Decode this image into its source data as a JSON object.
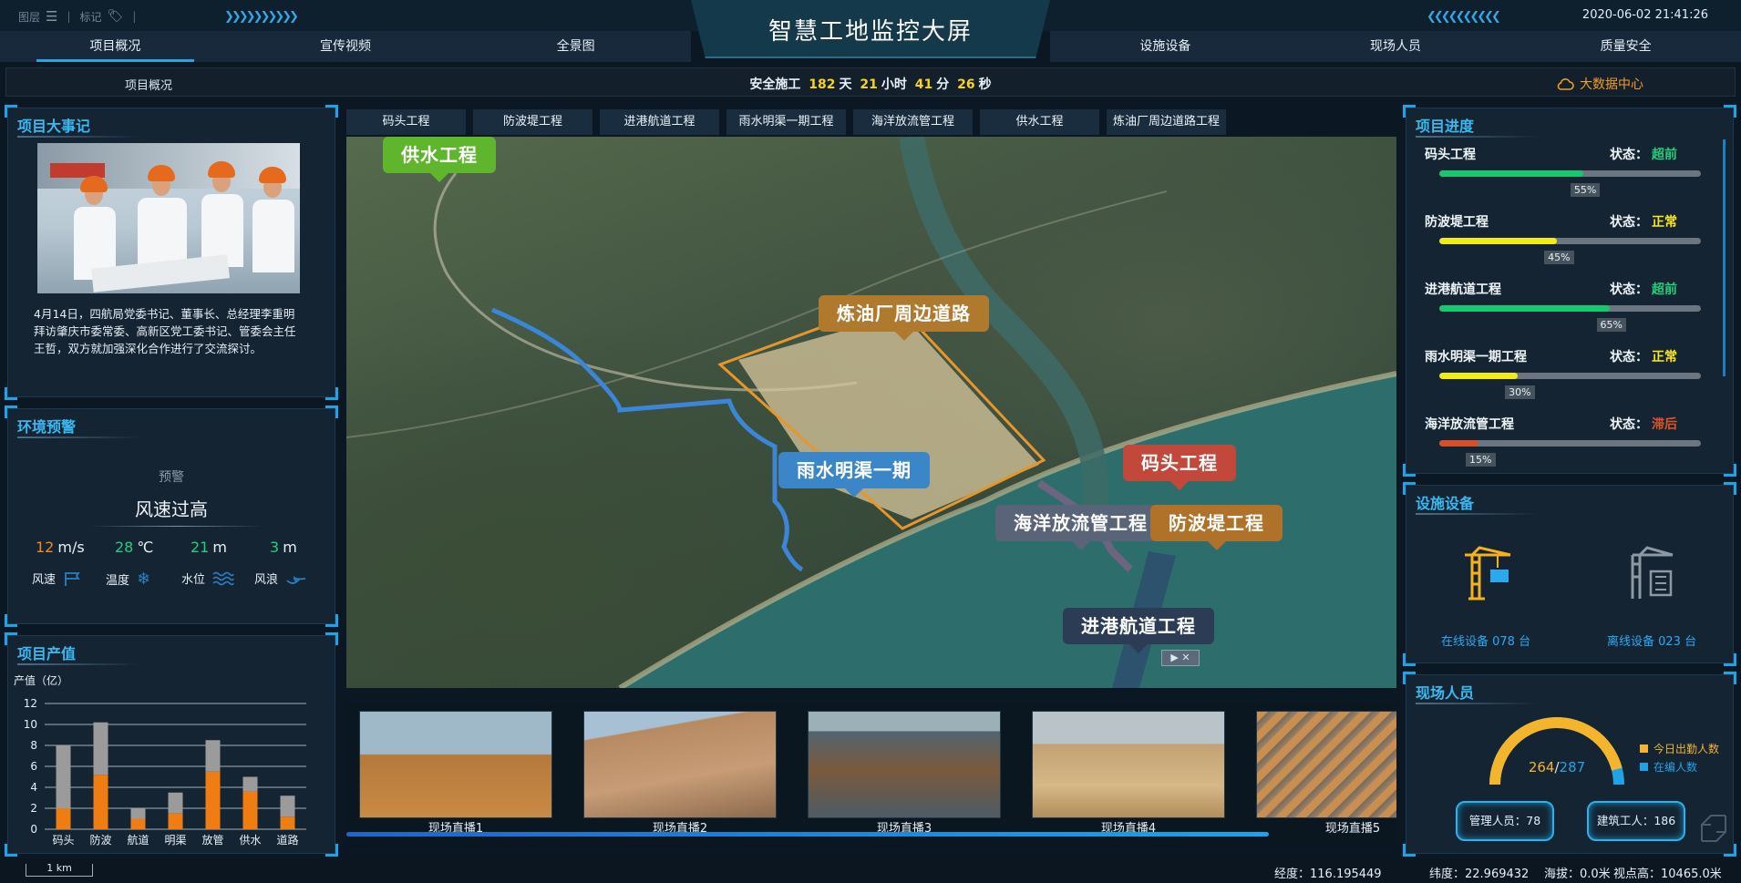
{
  "toolbar": {
    "layers_label": "图层",
    "mark_label": "标记",
    "sep": "|"
  },
  "datetime": "2020-06-02 21:41:26",
  "title": "智慧工地监控大屏",
  "nav": {
    "left": [
      "项目概况",
      "宣传视频",
      "全景图"
    ],
    "right": [
      "设施设备",
      "现场人员",
      "质量安全"
    ],
    "active": "项目概况"
  },
  "strip": {
    "label": "项目概况",
    "safety_prefix": "安全施工",
    "days": "182",
    "days_unit": "天",
    "hours": "21",
    "hours_unit": "小时",
    "minutes": "41",
    "minutes_unit": "分",
    "seconds": "26",
    "seconds_unit": "秒",
    "bigdata": "大数据中心"
  },
  "events": {
    "title": "项目大事记",
    "text": "4月14日，四航局党委书记、董事长、总经理李重明拜访肇庆市委常委、高新区党工委书记、管委会主任王哲，双方就加强深化合作进行了交流探讨。"
  },
  "env": {
    "title": "环境预警",
    "tag": "预警",
    "main": "风速过高",
    "metrics": [
      {
        "value": "12",
        "unit": "m/s",
        "label": "风速",
        "color": "#f08a24",
        "icon": "wind-icon"
      },
      {
        "value": "28",
        "unit": "℃",
        "label": "温度",
        "color": "#1fd07a",
        "icon": "temperature-icon"
      },
      {
        "value": "21",
        "unit": "m",
        "label": "水位",
        "color": "#1fd07a",
        "icon": "water-level-icon"
      },
      {
        "value": "3",
        "unit": "m",
        "label": "风浪",
        "color": "#1fd07a",
        "icon": "wave-icon"
      }
    ]
  },
  "output": {
    "title": "项目产值",
    "unit_label": "产值（亿）"
  },
  "chart_data": {
    "type": "bar",
    "stacked": true,
    "categories": [
      "码头",
      "防波",
      "航道",
      "明渠",
      "放管",
      "供水",
      "道路"
    ],
    "series": [
      {
        "values": [
          2,
          5.2,
          1,
          1.5,
          5.5,
          3.6,
          1.2
        ],
        "color": "#f07d11"
      },
      {
        "values": [
          6,
          5,
          1,
          2,
          3,
          1.4,
          2
        ],
        "color": "#9b9b9b"
      }
    ],
    "ylabel": "产值（亿）",
    "ylim": [
      0,
      12
    ],
    "yticks": [
      0,
      2,
      4,
      6,
      8,
      10,
      12
    ],
    "grid": true
  },
  "project_tabs": [
    "码头工程",
    "防波堤工程",
    "进港航道工程",
    "雨水明渠一期工程",
    "海洋放流管工程",
    "供水工程",
    "炼油厂周边道路工程"
  ],
  "map": {
    "labels": {
      "water": "供水工程",
      "oil": "炼油厂周边道路",
      "rain": "雨水明渠一期",
      "dock": "码头工程",
      "ocean": "海洋放流管工程",
      "breakwater": "防波堤工程",
      "port": "进港航道工程"
    },
    "control": "▶ ✕"
  },
  "live": {
    "items": [
      "现场直播1",
      "现场直播2",
      "现场直播3",
      "现场直播4",
      "现场直播5"
    ]
  },
  "progress": {
    "title": "项目进度",
    "status_label": "状态：",
    "items": [
      {
        "name": "码头工程",
        "status": "超前",
        "status_color": "#1fd07a",
        "pct": "55%",
        "value": 0.55,
        "bar_color": "#18c86f"
      },
      {
        "name": "防波堤工程",
        "status": "正常",
        "status_color": "#f8e71c",
        "pct": "45%",
        "value": 0.45,
        "bar_color": "#f2ec14"
      },
      {
        "name": "进港航道工程",
        "status": "超前",
        "status_color": "#1fd07a",
        "pct": "65%",
        "value": 0.65,
        "bar_color": "#18c86f"
      },
      {
        "name": "雨水明渠一期工程",
        "status": "正常",
        "status_color": "#f8e71c",
        "pct": "30%",
        "value": 0.3,
        "bar_color": "#f2ec14"
      },
      {
        "name": "海洋放流管工程",
        "status": "滞后",
        "status_color": "#e0532a",
        "pct": "15%",
        "value": 0.15,
        "bar_color": "#d8502a"
      }
    ]
  },
  "facilities": {
    "title": "设施设备",
    "online": "在线设备 078 台",
    "offline": "离线设备 023 台"
  },
  "personnel": {
    "title": "现场人员",
    "count": "264",
    "slash": "/",
    "total": "287",
    "legend_today": "今日出勤人数",
    "legend_staff": "在编人数",
    "mgmt": "管理人员：78",
    "workers": "建筑工人：186",
    "ratio": 0.92
  },
  "bottom": {
    "scale": "1 km",
    "lon": "经度：116.195449",
    "lat": "纬度：22.969432",
    "alt": "海拔：0.0米",
    "view": "视点高：10465.0米"
  }
}
